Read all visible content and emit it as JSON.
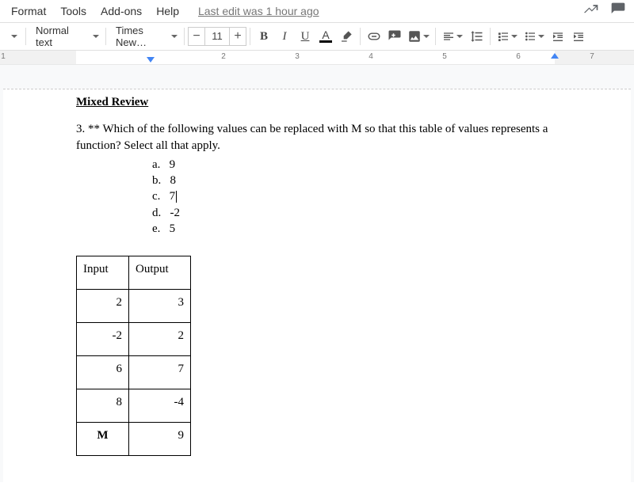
{
  "header": {
    "menus": [
      "Format",
      "Tools",
      "Add-ons",
      "Help"
    ],
    "last_edit": "Last edit was 1 hour ago"
  },
  "toolbar": {
    "style_dropdown": "Normal text",
    "font_dropdown": "Times New…",
    "font_size": "11",
    "minus": "−",
    "plus": "+",
    "bold": "B",
    "italic": "I",
    "underline": "U",
    "textcolor": "A"
  },
  "ruler": {
    "numbers": [
      "1",
      "2",
      "3",
      "4",
      "5",
      "6",
      "7"
    ]
  },
  "document": {
    "section_title": "Mixed Review",
    "question_text": "3. ** Which of the following values can be replaced with M so that this table of values represents a function? Select all that apply.",
    "options": [
      {
        "label": "a.",
        "value": "9"
      },
      {
        "label": "b.",
        "value": "8"
      },
      {
        "label": "c.",
        "value": "7"
      },
      {
        "label": "d.",
        "value": "-2"
      },
      {
        "label": "e.",
        "value": "5"
      }
    ],
    "table": {
      "head": [
        "Input",
        "Output"
      ],
      "rows": [
        [
          "2",
          "3"
        ],
        [
          "-2",
          "2"
        ],
        [
          "6",
          "7"
        ],
        [
          "8",
          "-4"
        ],
        [
          "M",
          "9"
        ]
      ]
    }
  }
}
